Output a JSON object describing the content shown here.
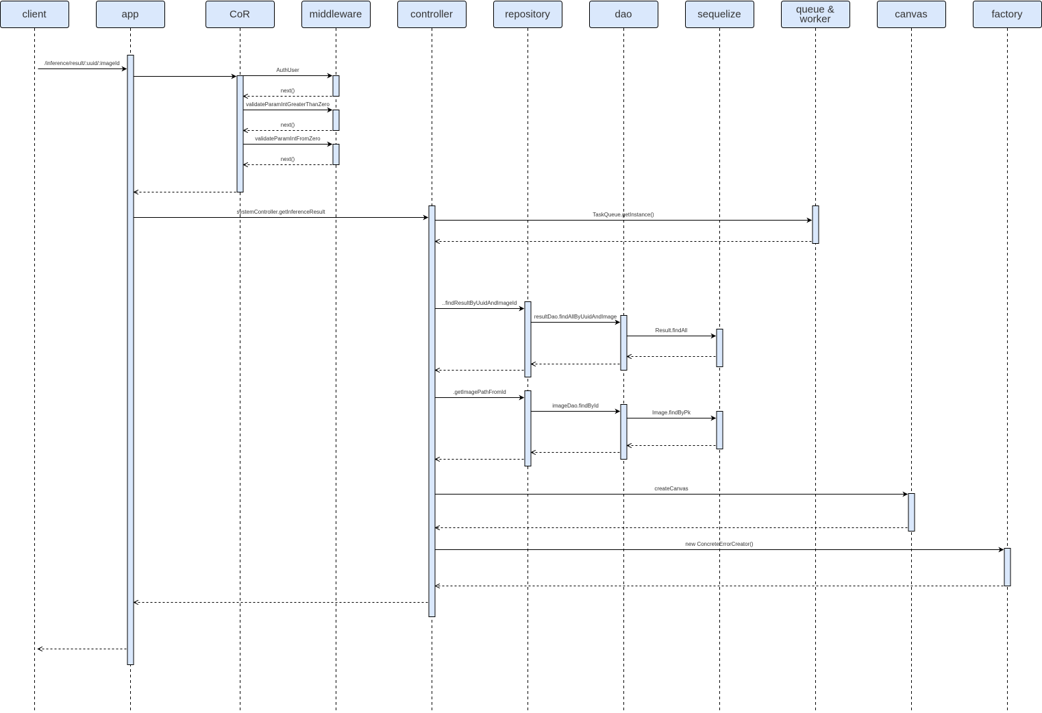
{
  "participants": [
    {
      "id": "client",
      "lines": [
        "client"
      ]
    },
    {
      "id": "app",
      "lines": [
        "app"
      ]
    },
    {
      "id": "cor",
      "lines": [
        "CoR"
      ]
    },
    {
      "id": "middleware",
      "lines": [
        "middleware"
      ]
    },
    {
      "id": "controller",
      "lines": [
        "controller"
      ]
    },
    {
      "id": "repository",
      "lines": [
        "repository"
      ]
    },
    {
      "id": "dao",
      "lines": [
        "dao"
      ]
    },
    {
      "id": "sequelize",
      "lines": [
        "sequelize"
      ]
    },
    {
      "id": "queue",
      "lines": [
        "queue &",
        "worker"
      ]
    },
    {
      "id": "canvas",
      "lines": [
        "canvas"
      ]
    },
    {
      "id": "factory",
      "lines": [
        "factory"
      ]
    }
  ],
  "messages": [
    {
      "id": "request",
      "from": "client",
      "to": "app",
      "label": "/inference/result/:uuid/:imageId",
      "kind": "call"
    },
    {
      "id": "app-to-cor",
      "from": "app",
      "to": "cor",
      "label": "",
      "kind": "call"
    },
    {
      "id": "auth-user",
      "from": "cor",
      "to": "middleware",
      "label": "AuthUser",
      "kind": "call"
    },
    {
      "id": "next-1",
      "from": "middleware",
      "to": "cor",
      "label": "next()",
      "kind": "return"
    },
    {
      "id": "validate-greater",
      "from": "cor",
      "to": "middleware",
      "label": "validateParamIntGreaterThanZero",
      "kind": "call"
    },
    {
      "id": "next-2",
      "from": "middleware",
      "to": "cor",
      "label": "next()",
      "kind": "return"
    },
    {
      "id": "validate-from-zero",
      "from": "cor",
      "to": "middleware",
      "label": "validateParamIntFromZero",
      "kind": "call"
    },
    {
      "id": "next-3",
      "from": "middleware",
      "to": "cor",
      "label": "next()",
      "kind": "return"
    },
    {
      "id": "cor-return",
      "from": "cor",
      "to": "app",
      "label": "",
      "kind": "return"
    },
    {
      "id": "get-inference-result",
      "from": "app",
      "to": "controller",
      "label": "systemController.getInferenceResult",
      "kind": "call"
    },
    {
      "id": "task-queue",
      "from": "controller",
      "to": "queue",
      "label": "TaskQueue.getInstance()",
      "kind": "call"
    },
    {
      "id": "task-queue-return",
      "from": "queue",
      "to": "controller",
      "label": "",
      "kind": "return"
    },
    {
      "id": "find-result",
      "from": "controller",
      "to": "repository",
      "label": "..findResultByUuidAndImageId",
      "kind": "call"
    },
    {
      "id": "result-dao",
      "from": "repository",
      "to": "dao",
      "label": "resultDao.findAllByUuidAndImage",
      "kind": "call"
    },
    {
      "id": "result-findall",
      "from": "dao",
      "to": "sequelize",
      "label": "Result.findAll",
      "kind": "call"
    },
    {
      "id": "result-findall-return",
      "from": "sequelize",
      "to": "dao",
      "label": "",
      "kind": "return"
    },
    {
      "id": "result-dao-return",
      "from": "dao",
      "to": "repository",
      "label": "",
      "kind": "return"
    },
    {
      "id": "find-result-return",
      "from": "repository",
      "to": "controller",
      "label": "",
      "kind": "return"
    },
    {
      "id": "get-image-path",
      "from": "controller",
      "to": "repository",
      "label": ".getImagePathFromId",
      "kind": "call"
    },
    {
      "id": "image-dao",
      "from": "repository",
      "to": "dao",
      "label": "imageDao.findById",
      "kind": "call"
    },
    {
      "id": "image-findbypk",
      "from": "dao",
      "to": "sequelize",
      "label": "Image.findByPk",
      "kind": "call"
    },
    {
      "id": "image-findbypk-return",
      "from": "sequelize",
      "to": "dao",
      "label": "",
      "kind": "return"
    },
    {
      "id": "image-dao-return",
      "from": "dao",
      "to": "repository",
      "label": "",
      "kind": "return"
    },
    {
      "id": "get-image-path-return",
      "from": "repository",
      "to": "controller",
      "label": "",
      "kind": "return"
    },
    {
      "id": "create-canvas",
      "from": "controller",
      "to": "canvas",
      "label": "createCanvas",
      "kind": "call"
    },
    {
      "id": "create-canvas-return",
      "from": "canvas",
      "to": "controller",
      "label": "",
      "kind": "return"
    },
    {
      "id": "error-creator",
      "from": "controller",
      "to": "factory",
      "label": "new ConcreteErrorCreator()",
      "kind": "call"
    },
    {
      "id": "error-creator-return",
      "from": "factory",
      "to": "controller",
      "label": "",
      "kind": "return"
    },
    {
      "id": "controller-return",
      "from": "controller",
      "to": "app",
      "label": "",
      "kind": "return"
    },
    {
      "id": "response",
      "from": "app",
      "to": "client",
      "label": "",
      "kind": "return"
    }
  ]
}
